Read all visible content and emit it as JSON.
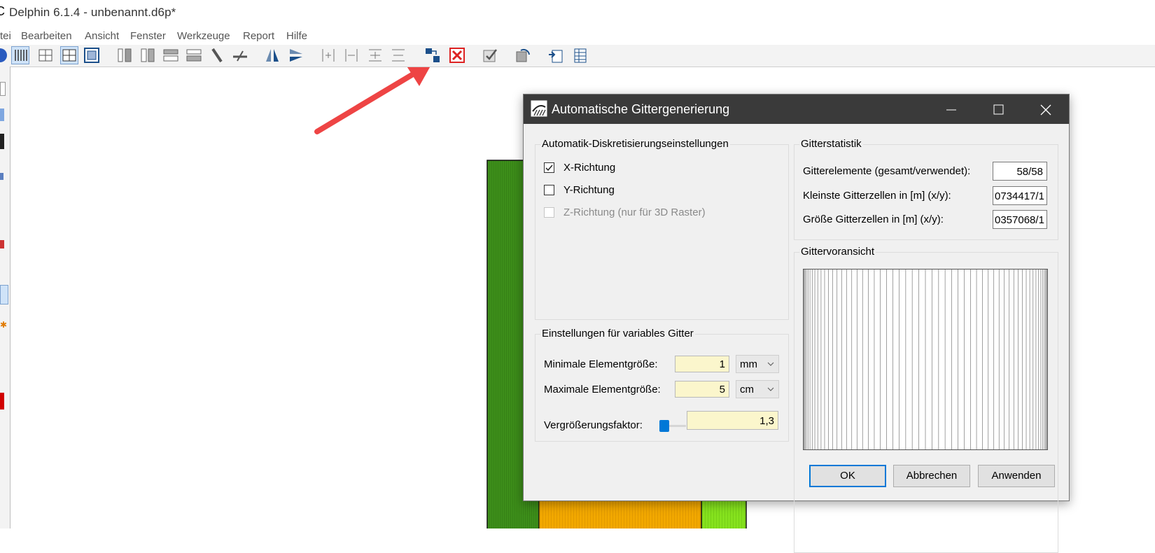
{
  "window": {
    "title": "Delphin 6.1.4 - unbenannt.d6p*"
  },
  "menu": {
    "items": [
      "tei",
      "Bearbeiten",
      "Ansicht",
      "Fenster",
      "Werkzeuge",
      "Report",
      "Hilfe"
    ]
  },
  "toolbar": {
    "icons": [
      "vertical-lines-icon",
      "grid-split-icon",
      "grid-select-icon",
      "grid-frame-icon",
      "column-hatch-icon",
      "column-merge-icon",
      "row-hatch-icon",
      "row-merge-icon",
      "diagonal-line-icon",
      "slanted-line-icon",
      "mirror-vertical-icon",
      "mirror-horizontal-icon",
      "insert-column-icon",
      "insert-row-icon",
      "split-rows-icon",
      "split-rows-alt-icon",
      "auto-grid-icon",
      "delete-grid-icon",
      "check-icon",
      "rotate-icon",
      "export-icon",
      "table-export-icon"
    ]
  },
  "annotation": {
    "arrow_color": "#ee4444"
  },
  "canvas": {
    "colors": {
      "green": "#3d8e1a",
      "orange": "#f2a800",
      "lime": "#86e21e"
    }
  },
  "dialog": {
    "title": "Automatische Gittergenerierung",
    "auto_group": {
      "title": "Automatik-Diskretisierungseinstellungen",
      "x_direction": {
        "label": "X-Richtung",
        "checked": true
      },
      "y_direction": {
        "label": "Y-Richtung",
        "checked": false
      },
      "z_direction": {
        "label": "Z-Richtung (nur für 3D Raster)",
        "checked": false,
        "enabled": false
      }
    },
    "variable_group": {
      "title": "Einstellungen für variables Gitter",
      "min_label": "Minimale Elementgröße:",
      "min_value": "1",
      "min_unit": "mm",
      "max_label": "Maximale Elementgröße:",
      "max_value": "5",
      "max_unit": "cm",
      "factor_label": "Vergrößerungsfaktor:",
      "factor_value": "1,3"
    },
    "stats_group": {
      "title": "Gitterstatistik",
      "elements_label": "Gitterelemente (gesamt/verwendet):",
      "elements_value": "58/58",
      "smallest_label": "Kleinste Gitterzellen in [m] (x/y):",
      "smallest_value": "0734417/1",
      "largest_label": "Größe Gitterzellen in [m] (x/y):",
      "largest_value": "0357068/1"
    },
    "preview_group": {
      "title": "Gittervoransicht"
    },
    "buttons": {
      "ok": "OK",
      "cancel": "Abbrechen",
      "apply": "Anwenden"
    }
  }
}
